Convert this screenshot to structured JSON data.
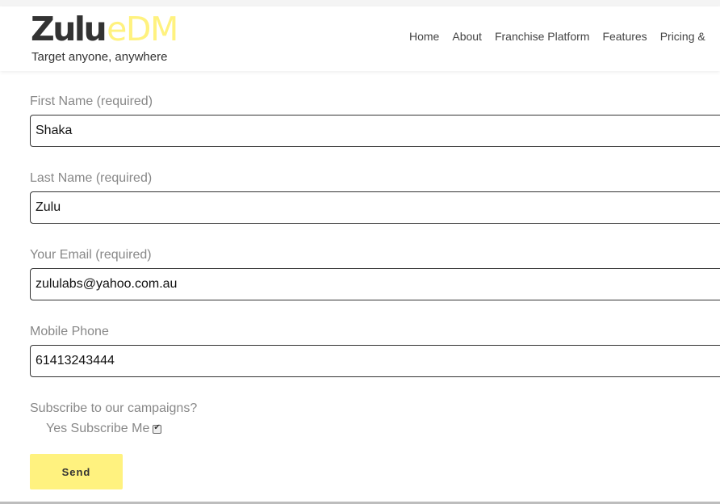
{
  "brand": {
    "logo_main": "Zulu",
    "logo_accent": "eDM",
    "tagline": "Target anyone, anywhere",
    "accent_color": "#fff27f"
  },
  "nav": {
    "items": [
      "Home",
      "About",
      "Franchise Platform",
      "Features",
      "Pricing &"
    ]
  },
  "form": {
    "first_name": {
      "label": "First Name (required)",
      "value": "Shaka"
    },
    "last_name": {
      "label": "Last Name (required)",
      "value": "Zulu"
    },
    "email": {
      "label": "Your Email (required)",
      "value": "zululabs@yahoo.com.au"
    },
    "mobile": {
      "label": "Mobile Phone",
      "value": "61413243444"
    },
    "subscribe": {
      "question": "Subscribe to our campaigns?",
      "option_label": "Yes Subscribe Me",
      "checked": true
    },
    "send_label": "Send"
  }
}
